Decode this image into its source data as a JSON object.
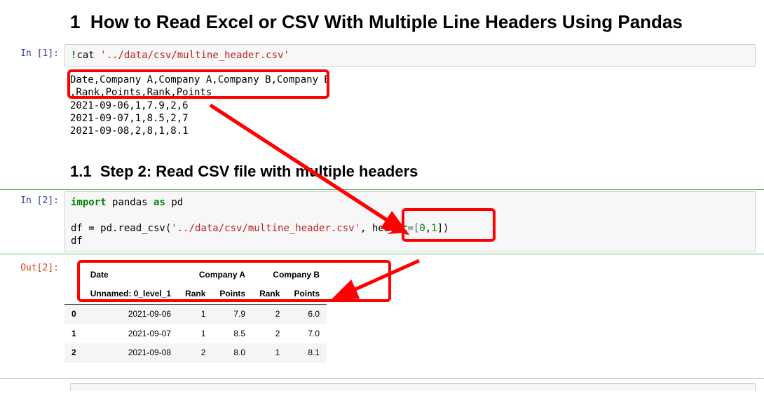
{
  "headings": {
    "main_number": "1",
    "main_title": "How to Read Excel or CSV With Multiple Line Headers Using Pandas",
    "sub_number": "1.1",
    "sub_title": "Step 2: Read CSV file with multiple headers"
  },
  "cell1": {
    "prompt": "In [1]:",
    "magic": "!",
    "cmd": "cat",
    "path": "'../data/csv/multine_header.csv'",
    "output_lines": [
      "Date,Company A,Company A,Company B,Company B",
      ",Rank,Points,Rank,Points",
      "2021-09-06,1,7.9,2,6",
      "2021-09-07,1,8.5,2,7",
      "2021-09-08,2,8,1,8.1"
    ]
  },
  "cell2": {
    "prompt": "In [2]:",
    "kw_import": "import",
    "mod": "pandas",
    "kw_as": "as",
    "alias": "pd",
    "assign": "df = pd.read_csv(",
    "arg_path": "'../data/csv/multine_header.csv'",
    "comma": ", ",
    "kw_header": "header",
    "eq": "=[",
    "n0": "0",
    "c2": ",",
    "n1": "1",
    "close": "])",
    "last": "df"
  },
  "out2": {
    "prompt": "Out[2]:",
    "top_headers": [
      "Date",
      "Company A",
      "Company B"
    ],
    "sub_headers": [
      "Unnamed: 0_level_1",
      "Rank",
      "Points",
      "Rank",
      "Points"
    ],
    "rows": [
      {
        "idx": "0",
        "date": "2021-09-06",
        "a_rank": "1",
        "a_pts": "7.9",
        "b_rank": "2",
        "b_pts": "6.0"
      },
      {
        "idx": "1",
        "date": "2021-09-07",
        "a_rank": "1",
        "a_pts": "8.5",
        "b_rank": "2",
        "b_pts": "7.0"
      },
      {
        "idx": "2",
        "date": "2021-09-08",
        "a_rank": "2",
        "a_pts": "8.0",
        "b_rank": "1",
        "b_pts": "8.1"
      }
    ]
  }
}
